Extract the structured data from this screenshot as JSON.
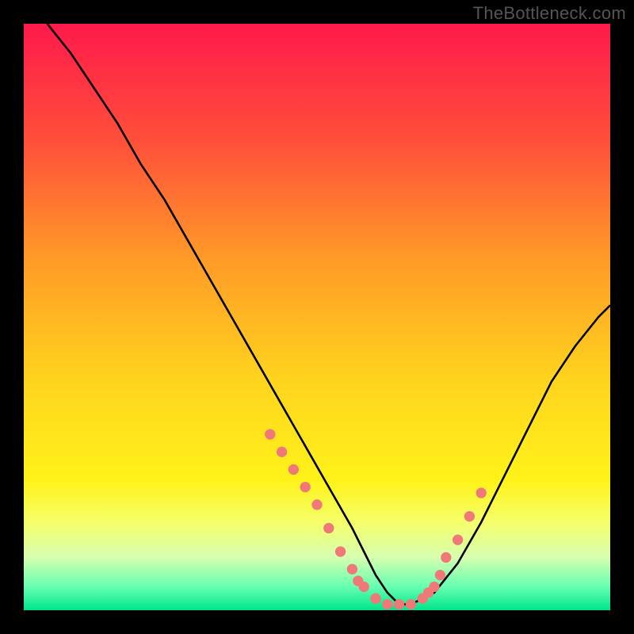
{
  "watermark": "TheBottleneck.com",
  "chart_data": {
    "type": "line",
    "title": "",
    "xlabel": "",
    "ylabel": "",
    "xlim": [
      0,
      100
    ],
    "ylim": [
      0,
      100
    ],
    "gradient_stops": [
      {
        "offset": 0,
        "color": "#ff1a4b"
      },
      {
        "offset": 20,
        "color": "#ff4f3a"
      },
      {
        "offset": 40,
        "color": "#ff9a28"
      },
      {
        "offset": 60,
        "color": "#ffd21e"
      },
      {
        "offset": 78,
        "color": "#fff31a"
      },
      {
        "offset": 85,
        "color": "#f5ff6a"
      },
      {
        "offset": 91,
        "color": "#d6ffb0"
      },
      {
        "offset": 96,
        "color": "#66ffb0"
      },
      {
        "offset": 100,
        "color": "#00e58a"
      }
    ],
    "series": [
      {
        "name": "curve",
        "x": [
          4,
          8,
          12,
          16,
          20,
          24,
          28,
          32,
          36,
          40,
          44,
          48,
          52,
          56,
          58,
          60,
          62,
          64,
          66,
          70,
          74,
          78,
          82,
          86,
          90,
          94,
          98,
          100
        ],
        "y": [
          100,
          95,
          89,
          83,
          76,
          70,
          63,
          56,
          49,
          42,
          35,
          28,
          21,
          14,
          10,
          6,
          3,
          1,
          1,
          3,
          8,
          15,
          23,
          31,
          39,
          45,
          50,
          52
        ]
      }
    ],
    "scatter_points": {
      "name": "markers",
      "x": [
        42,
        44,
        46,
        48,
        50,
        52,
        54,
        56,
        57,
        58,
        60,
        62,
        64,
        66,
        68,
        69,
        70,
        71,
        72,
        74,
        76,
        78
      ],
      "y": [
        30,
        27,
        24,
        21,
        18,
        14,
        10,
        7,
        5,
        4,
        2,
        1,
        1,
        1,
        2,
        3,
        4,
        6,
        9,
        12,
        16,
        20
      ]
    },
    "banding_hint": "Horizontal gradient from red (top) through orange/yellow to green (bottom); a black V-shaped curve with salmon dots clustered near the trough; thick black frame."
  }
}
